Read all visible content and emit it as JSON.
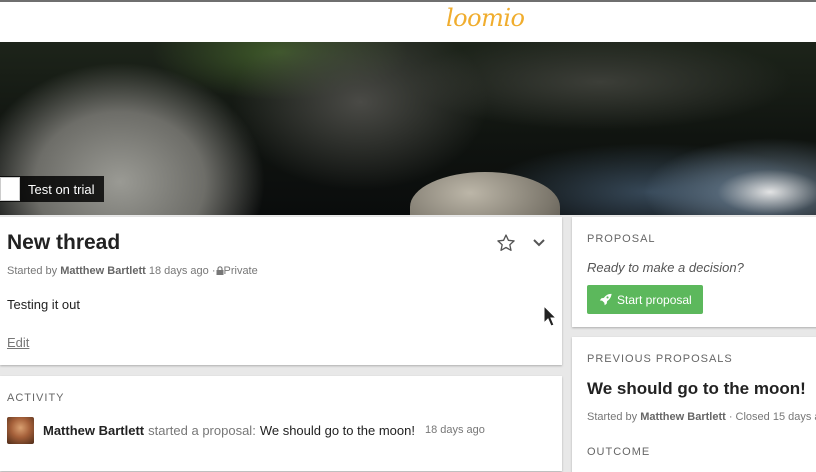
{
  "header": {
    "logo_text": "loomio"
  },
  "group": {
    "name": "Test on trial"
  },
  "thread": {
    "title": "New thread",
    "started_by_label": "Started by",
    "author": "Matthew Bartlett",
    "time_ago": "18 days ago",
    "separator": "·",
    "privacy": "Private",
    "body": "Testing it out",
    "edit_label": "Edit",
    "icons": {
      "star": "star-icon",
      "menu": "chevron-down-icon",
      "privacy": "lock-icon"
    }
  },
  "activity": {
    "label": "ACTIVITY",
    "items": [
      {
        "actor": "Matthew Bartlett",
        "verb": "started a proposal:",
        "target": "We should go to the moon!",
        "time_ago": "18 days ago"
      }
    ]
  },
  "proposal": {
    "label": "PROPOSAL",
    "prompt": "Ready to make a decision?",
    "button_label": "Start proposal",
    "button_icon": "rocket-icon"
  },
  "previous_proposals": {
    "label": "PREVIOUS PROPOSALS",
    "title": "We should go to the moon!",
    "started_by_label": "Started by",
    "author": "Matthew Bartlett",
    "closed_text": "· Closed 15 days a",
    "outcome_label": "OUTCOME"
  },
  "colors": {
    "logo": "#f0ad2e",
    "primary_button": "#5cb85c",
    "background": "#e8e8e8"
  }
}
